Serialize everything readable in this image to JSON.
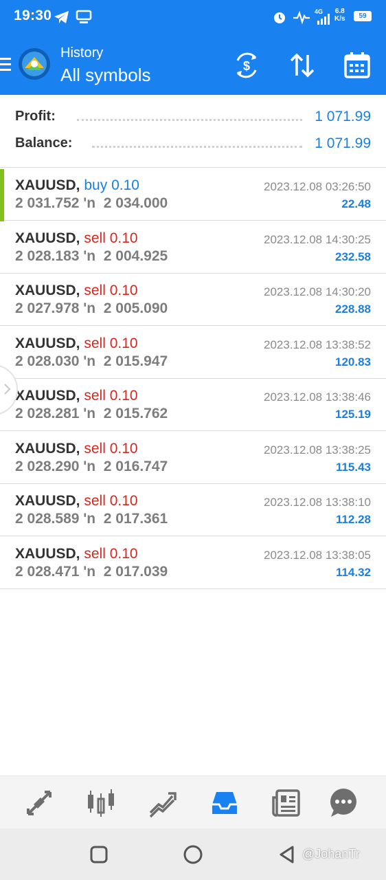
{
  "status_bar": {
    "time": "19:30",
    "network_speed_line1": "6.8",
    "network_speed_line2": "K/s",
    "network_type": "4G",
    "battery": "59"
  },
  "app_bar": {
    "subtitle": "History",
    "title": "All symbols",
    "actions": [
      "currency-exchange-icon",
      "sort-icon",
      "calendar-icon"
    ]
  },
  "summary": {
    "profit_label": "Profit:",
    "profit_value": "1 071.99",
    "balance_label": "Balance:",
    "balance_value": "1 071.99"
  },
  "trades": [
    {
      "symbol": "XAUUSD,",
      "type": "buy",
      "volume": "0.10",
      "open": "2 031.752",
      "arrow": "'n",
      "close": "2 034.000",
      "time": "2023.12.08 03:26:50",
      "profit": "22.48"
    },
    {
      "symbol": "XAUUSD,",
      "type": "sell",
      "volume": "0.10",
      "open": "2 028.183",
      "arrow": "'n",
      "close": "2 004.925",
      "time": "2023.12.08 14:30:25",
      "profit": "232.58"
    },
    {
      "symbol": "XAUUSD,",
      "type": "sell",
      "volume": "0.10",
      "open": "2 027.978",
      "arrow": "'n",
      "close": "2 005.090",
      "time": "2023.12.08 14:30:20",
      "profit": "228.88"
    },
    {
      "symbol": "XAUUSD,",
      "type": "sell",
      "volume": "0.10",
      "open": "2 028.030",
      "arrow": "'n",
      "close": "2 015.947",
      "time": "2023.12.08 13:38:52",
      "profit": "120.83"
    },
    {
      "symbol": "XAUUSD,",
      "type": "sell",
      "volume": "0.10",
      "open": "2 028.281",
      "arrow": "'n",
      "close": "2 015.762",
      "time": "2023.12.08 13:38:46",
      "profit": "125.19"
    },
    {
      "symbol": "XAUUSD,",
      "type": "sell",
      "volume": "0.10",
      "open": "2 028.290",
      "arrow": "'n",
      "close": "2 016.747",
      "time": "2023.12.08 13:38:25",
      "profit": "115.43"
    },
    {
      "symbol": "XAUUSD,",
      "type": "sell",
      "volume": "0.10",
      "open": "2 028.589",
      "arrow": "'n",
      "close": "2 017.361",
      "time": "2023.12.08 13:38:10",
      "profit": "112.28"
    },
    {
      "symbol": "XAUUSD,",
      "type": "sell",
      "volume": "0.10",
      "open": "2 028.471",
      "arrow": "'n",
      "close": "2 017.039",
      "time": "2023.12.08 13:38:05",
      "profit": "114.32"
    }
  ],
  "bottom_nav": [
    "quotes-icon",
    "chart-icon",
    "trade-icon",
    "history-icon",
    "news-icon",
    "chat-icon"
  ],
  "active_tab": "history-icon",
  "watermark": "@JohanTr",
  "colors": {
    "primary": "#1a82f0",
    "buy": "#1a7fe0",
    "sell": "#d7261d",
    "profit": "#1a7fe0",
    "accent_bar": "#7fc01c"
  }
}
